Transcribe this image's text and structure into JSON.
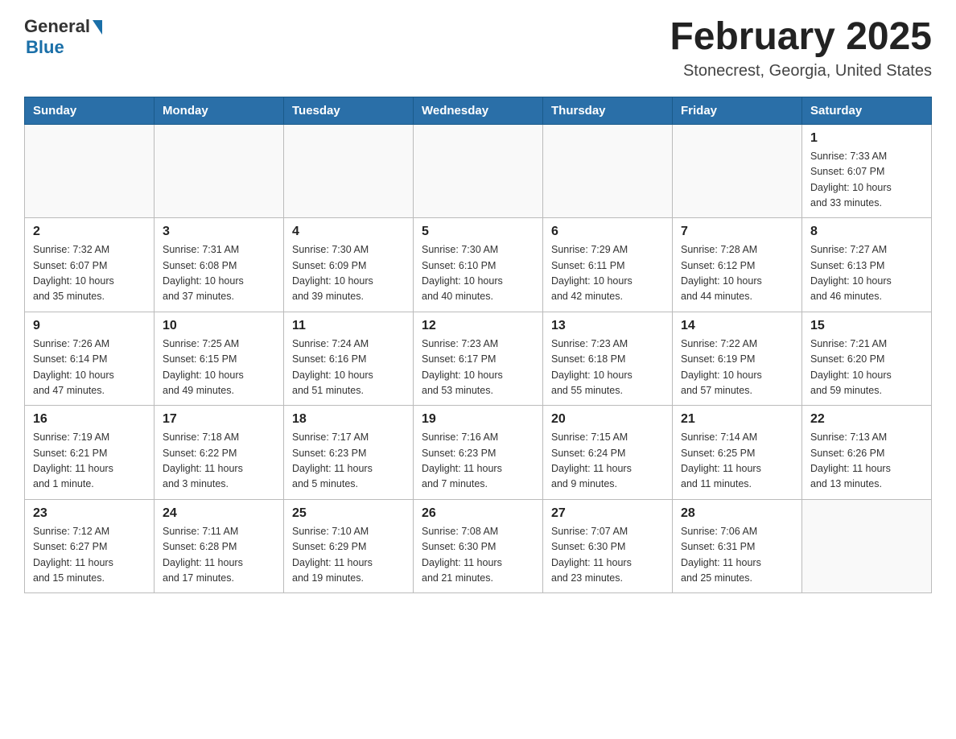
{
  "header": {
    "logo_general": "General",
    "logo_blue": "Blue",
    "title": "February 2025",
    "location": "Stonecrest, Georgia, United States"
  },
  "days_of_week": [
    "Sunday",
    "Monday",
    "Tuesday",
    "Wednesday",
    "Thursday",
    "Friday",
    "Saturday"
  ],
  "weeks": [
    [
      {
        "day": "",
        "info": ""
      },
      {
        "day": "",
        "info": ""
      },
      {
        "day": "",
        "info": ""
      },
      {
        "day": "",
        "info": ""
      },
      {
        "day": "",
        "info": ""
      },
      {
        "day": "",
        "info": ""
      },
      {
        "day": "1",
        "info": "Sunrise: 7:33 AM\nSunset: 6:07 PM\nDaylight: 10 hours\nand 33 minutes."
      }
    ],
    [
      {
        "day": "2",
        "info": "Sunrise: 7:32 AM\nSunset: 6:07 PM\nDaylight: 10 hours\nand 35 minutes."
      },
      {
        "day": "3",
        "info": "Sunrise: 7:31 AM\nSunset: 6:08 PM\nDaylight: 10 hours\nand 37 minutes."
      },
      {
        "day": "4",
        "info": "Sunrise: 7:30 AM\nSunset: 6:09 PM\nDaylight: 10 hours\nand 39 minutes."
      },
      {
        "day": "5",
        "info": "Sunrise: 7:30 AM\nSunset: 6:10 PM\nDaylight: 10 hours\nand 40 minutes."
      },
      {
        "day": "6",
        "info": "Sunrise: 7:29 AM\nSunset: 6:11 PM\nDaylight: 10 hours\nand 42 minutes."
      },
      {
        "day": "7",
        "info": "Sunrise: 7:28 AM\nSunset: 6:12 PM\nDaylight: 10 hours\nand 44 minutes."
      },
      {
        "day": "8",
        "info": "Sunrise: 7:27 AM\nSunset: 6:13 PM\nDaylight: 10 hours\nand 46 minutes."
      }
    ],
    [
      {
        "day": "9",
        "info": "Sunrise: 7:26 AM\nSunset: 6:14 PM\nDaylight: 10 hours\nand 47 minutes."
      },
      {
        "day": "10",
        "info": "Sunrise: 7:25 AM\nSunset: 6:15 PM\nDaylight: 10 hours\nand 49 minutes."
      },
      {
        "day": "11",
        "info": "Sunrise: 7:24 AM\nSunset: 6:16 PM\nDaylight: 10 hours\nand 51 minutes."
      },
      {
        "day": "12",
        "info": "Sunrise: 7:23 AM\nSunset: 6:17 PM\nDaylight: 10 hours\nand 53 minutes."
      },
      {
        "day": "13",
        "info": "Sunrise: 7:23 AM\nSunset: 6:18 PM\nDaylight: 10 hours\nand 55 minutes."
      },
      {
        "day": "14",
        "info": "Sunrise: 7:22 AM\nSunset: 6:19 PM\nDaylight: 10 hours\nand 57 minutes."
      },
      {
        "day": "15",
        "info": "Sunrise: 7:21 AM\nSunset: 6:20 PM\nDaylight: 10 hours\nand 59 minutes."
      }
    ],
    [
      {
        "day": "16",
        "info": "Sunrise: 7:19 AM\nSunset: 6:21 PM\nDaylight: 11 hours\nand 1 minute."
      },
      {
        "day": "17",
        "info": "Sunrise: 7:18 AM\nSunset: 6:22 PM\nDaylight: 11 hours\nand 3 minutes."
      },
      {
        "day": "18",
        "info": "Sunrise: 7:17 AM\nSunset: 6:23 PM\nDaylight: 11 hours\nand 5 minutes."
      },
      {
        "day": "19",
        "info": "Sunrise: 7:16 AM\nSunset: 6:23 PM\nDaylight: 11 hours\nand 7 minutes."
      },
      {
        "day": "20",
        "info": "Sunrise: 7:15 AM\nSunset: 6:24 PM\nDaylight: 11 hours\nand 9 minutes."
      },
      {
        "day": "21",
        "info": "Sunrise: 7:14 AM\nSunset: 6:25 PM\nDaylight: 11 hours\nand 11 minutes."
      },
      {
        "day": "22",
        "info": "Sunrise: 7:13 AM\nSunset: 6:26 PM\nDaylight: 11 hours\nand 13 minutes."
      }
    ],
    [
      {
        "day": "23",
        "info": "Sunrise: 7:12 AM\nSunset: 6:27 PM\nDaylight: 11 hours\nand 15 minutes."
      },
      {
        "day": "24",
        "info": "Sunrise: 7:11 AM\nSunset: 6:28 PM\nDaylight: 11 hours\nand 17 minutes."
      },
      {
        "day": "25",
        "info": "Sunrise: 7:10 AM\nSunset: 6:29 PM\nDaylight: 11 hours\nand 19 minutes."
      },
      {
        "day": "26",
        "info": "Sunrise: 7:08 AM\nSunset: 6:30 PM\nDaylight: 11 hours\nand 21 minutes."
      },
      {
        "day": "27",
        "info": "Sunrise: 7:07 AM\nSunset: 6:30 PM\nDaylight: 11 hours\nand 23 minutes."
      },
      {
        "day": "28",
        "info": "Sunrise: 7:06 AM\nSunset: 6:31 PM\nDaylight: 11 hours\nand 25 minutes."
      },
      {
        "day": "",
        "info": ""
      }
    ]
  ]
}
